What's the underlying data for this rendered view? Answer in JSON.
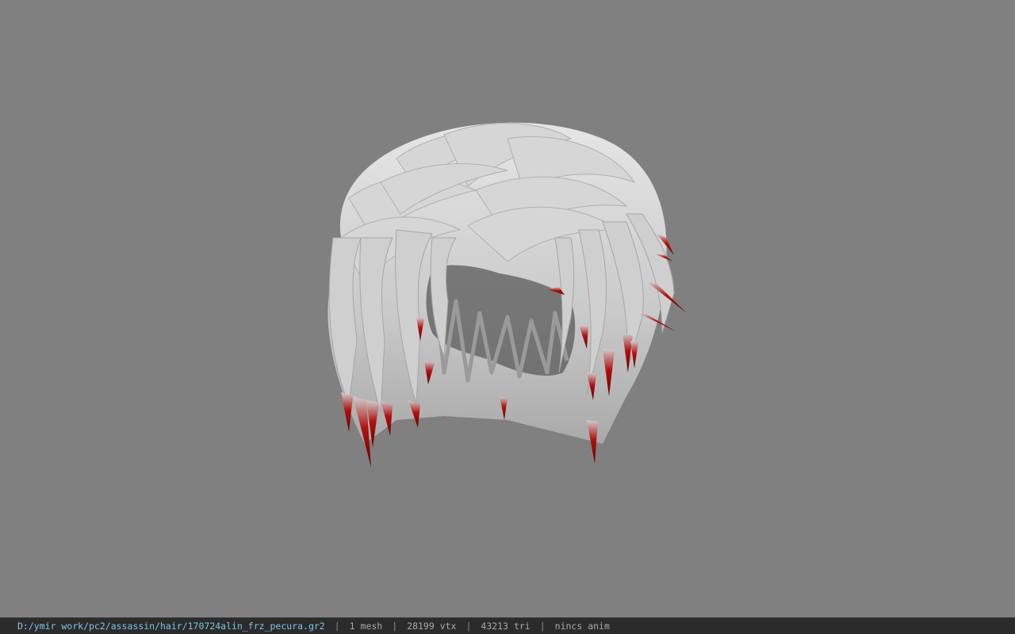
{
  "viewport": {
    "background": "#808080",
    "model": "hair-mesh",
    "model_base_color": "#d8d8d8",
    "model_tip_color": "#b01010"
  },
  "statusbar": {
    "file_path": "D:/ymir work/pc2/assassin/hair/170724alin_frz_pecura.gr2",
    "separator": "|",
    "mesh_count": "1 mesh",
    "vertex_count": "28199 vtx",
    "triangle_count": "43213 tri",
    "animation": "nincs anim",
    "path_color": "#7fc4e6"
  }
}
